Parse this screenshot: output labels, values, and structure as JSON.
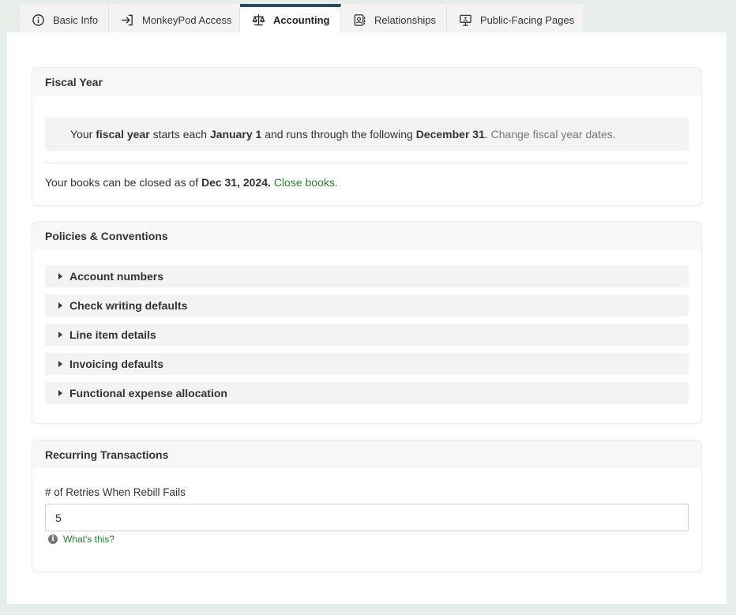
{
  "tabs": [
    {
      "label": "Basic Info",
      "icon": "info-circle-icon",
      "active": false
    },
    {
      "label": "MonkeyPod Access",
      "icon": "sign-in-icon",
      "active": false
    },
    {
      "label": "Accounting",
      "icon": "scales-icon",
      "active": true
    },
    {
      "label": "Relationships",
      "icon": "contact-book-icon",
      "active": false
    },
    {
      "label": "Public-Facing Pages",
      "icon": "presentation-screen-icon",
      "active": false
    }
  ],
  "fiscal_year": {
    "title": "Fiscal Year",
    "notice": {
      "p1": "Your ",
      "b1": "fiscal year",
      "p2": " starts each ",
      "b2": "January 1",
      "p3": " and runs through the following ",
      "b3": "December 31",
      "p4": ". ",
      "link": "Change fiscal year dates."
    },
    "books": {
      "p1": "Your books can be closed as of ",
      "date": "Dec 31, 2024.",
      "link": "Close books."
    }
  },
  "policies": {
    "title": "Policies & Conventions",
    "items": [
      "Account numbers",
      "Check writing defaults",
      "Line item details",
      "Invoicing defaults",
      "Functional expense allocation"
    ]
  },
  "recurring": {
    "title": "Recurring Transactions",
    "retries_label": "# of Retries When Rebill Fails",
    "retries_value": "5",
    "help_link": "What's this?"
  },
  "colors": {
    "accent_tab_border": "#2c4a5e",
    "link_green": "#2e7d32",
    "page_background": "#e7eeea"
  }
}
